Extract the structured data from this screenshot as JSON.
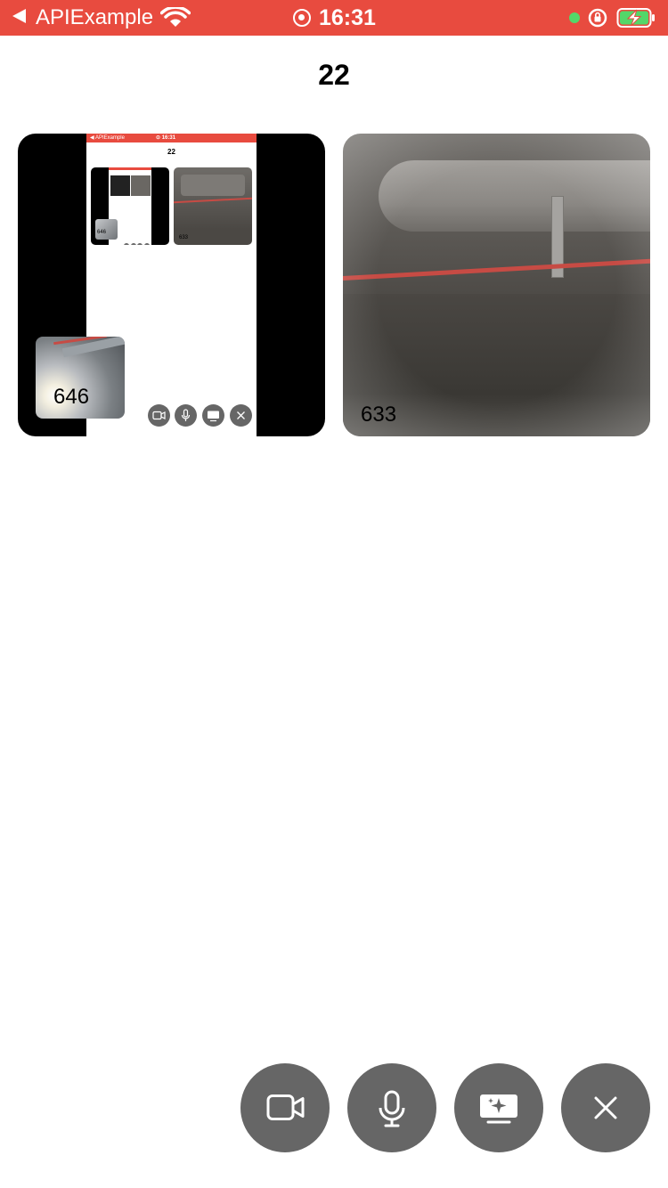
{
  "status_bar": {
    "back_app": "APIExample",
    "time": "16:31"
  },
  "page": {
    "title": "22"
  },
  "tiles": {
    "local": {
      "label": "646",
      "mini_screen": {
        "back_app": "◀ APIExample",
        "time": "⊙ 16:31",
        "title": "22",
        "tile_a_label": "646",
        "tile_b_label": "633"
      }
    },
    "remote": {
      "label": "633"
    }
  },
  "controls": {
    "video_icon": "video-camera-icon",
    "mic_icon": "microphone-icon",
    "screen_icon": "screen-share-icon",
    "close_icon": "close-icon"
  }
}
